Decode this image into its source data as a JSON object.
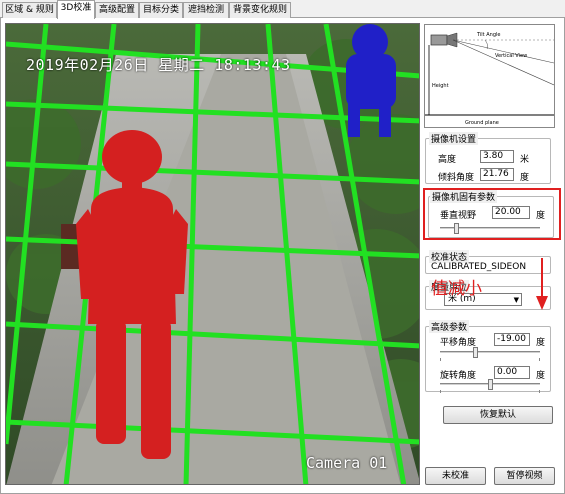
{
  "tabs": [
    "区域 & 规则",
    "3D校准",
    "高级配置",
    "目标分类",
    "遮挡检测",
    "背景变化规则"
  ],
  "active_tab": "3D校准",
  "video": {
    "timestamp": "2019年02月26日  星期二  18:13:43",
    "camera_label": "Camera 01"
  },
  "diagram": {
    "labels": [
      "Tilt Angle",
      "Vertical View",
      "Height",
      "Ground plane"
    ]
  },
  "camera_settings": {
    "title": "摄像机设置",
    "height_label": "高度",
    "height_value": "3.80",
    "height_unit": "米",
    "tilt_label": "倾斜角度",
    "tilt_value": "21.76",
    "tilt_unit": "度"
  },
  "intrinsics": {
    "title": "摄像机固有参数",
    "vfov_label": "垂直视野",
    "vfov_value": "20.00",
    "vfov_unit": "度",
    "vfov_slider_fraction": 0.15
  },
  "calib_state": {
    "title": "校准状态",
    "value": "CALIBRATED_SIDEON"
  },
  "unit_group": {
    "title": "度量单位",
    "selected": "米 (m)"
  },
  "advanced": {
    "title": "高级参数",
    "pan_label": "平移角度",
    "pan_value": "-19.00",
    "pan_unit": "度",
    "pan_slider_fraction": 0.35,
    "rot_label": "旋转角度",
    "rot_value": "0.00",
    "rot_unit": "度",
    "rot_slider_fraction": 0.5
  },
  "buttons": {
    "restore": "恢复默认",
    "uncalibrate": "未校准",
    "pause": "暂停视频"
  },
  "annotation": {
    "text": "值减小"
  },
  "colors": {
    "grid": "#22e022",
    "person_red": "#d42020",
    "person_blue": "#2020c8",
    "annotation": "#e02020"
  }
}
